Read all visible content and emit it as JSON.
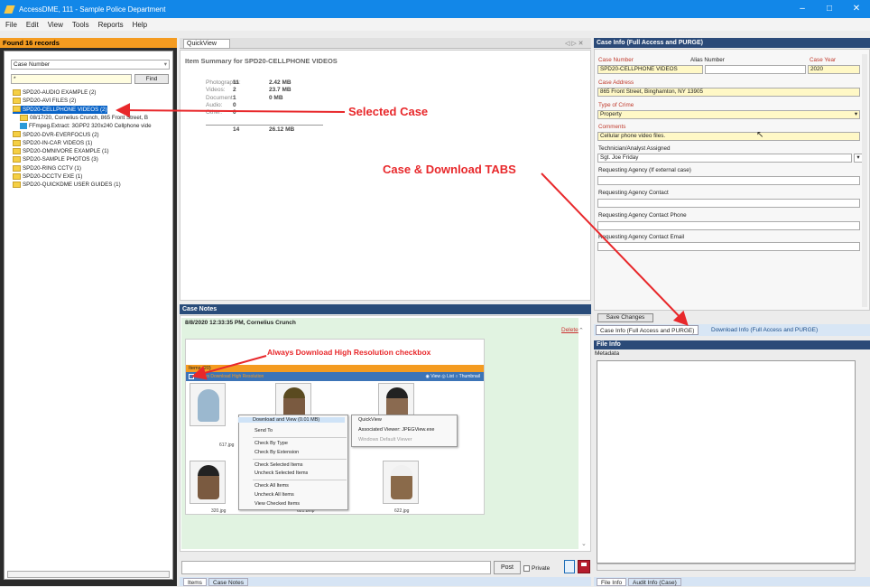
{
  "window": {
    "title": "AccessDME, 111 - Sample Police Department",
    "minimize": "–",
    "maximize": "□",
    "close": "✕"
  },
  "menu": [
    "File",
    "Edit",
    "View",
    "Tools",
    "Reports",
    "Help"
  ],
  "left": {
    "header": "Found 16 records",
    "search_field": "Case Number",
    "search_value": "*",
    "find_label": "Find",
    "tree": [
      {
        "label": "SPD20-AUDIO EXAMPLE (2)",
        "type": "folder",
        "indent": 0
      },
      {
        "label": "SPD20-AVI FILES (2)",
        "type": "folder",
        "indent": 0
      },
      {
        "label": "SPD20-CELLPHONE VIDEOS (2)",
        "type": "folder",
        "indent": 0,
        "selected": true
      },
      {
        "label": "08/17/20, Cornelius Crunch, 865 Front Street, B",
        "type": "folder",
        "indent": 1
      },
      {
        "label": "FFmpeg.Extract: 3GPP2 320x240 Cellphone vide",
        "type": "file",
        "indent": 1
      },
      {
        "label": "SPD20-DVR-EVERFOCUS (2)",
        "type": "folder",
        "indent": 0
      },
      {
        "label": "SPD20-IN-CAR VIDEOS (1)",
        "type": "folder",
        "indent": 0
      },
      {
        "label": "SPD20-OMNIVORE EXAMPLE (1)",
        "type": "folder",
        "indent": 0
      },
      {
        "label": "SPD20-SAMPLE PHOTOS (3)",
        "type": "folder",
        "indent": 0
      },
      {
        "label": "SPD20-RING CCTV (1)",
        "type": "folder",
        "indent": 0
      },
      {
        "label": "SPD20-DCCTV EXE (1)",
        "type": "folder",
        "indent": 0
      },
      {
        "label": "SPD20-QUICKDME USER GUIDES (1)",
        "type": "folder",
        "indent": 0
      }
    ]
  },
  "quickview": {
    "tab": "QuickView",
    "nav": "◁ ▷ ✕",
    "summary_title": "Item Summary for SPD20-CELLPHONE VIDEOS",
    "rows": [
      {
        "label": "Photographs:",
        "count": "11",
        "size": "2.42 MB"
      },
      {
        "label": "Videos:",
        "count": "2",
        "size": "23.7 MB"
      },
      {
        "label": "Document:",
        "count": "1",
        "size": "0 MB"
      },
      {
        "label": "Audio:",
        "count": "0",
        "size": ""
      },
      {
        "label": "Other:",
        "count": "0",
        "size": ""
      }
    ],
    "total_count": "14",
    "total_size": "26.12 MB"
  },
  "notes": {
    "header": "Case Notes",
    "author": "8/8/2020 12:33:35 PM, Cornelius Crunch",
    "delete_label": "Delete",
    "embedded": {
      "items_bar": "Items (20)",
      "toolbar_left": "Always Download High Resolution",
      "toolbar_right": "◉ View ◎ List ○ Thumbnail",
      "thumb_labels": [
        "617.jpg",
        "320.jpg",
        "621.bmp",
        "622.jpg"
      ],
      "context_menu": [
        "Download and View (0.01 MB)",
        "Send To",
        "Check By Type",
        "Check By Extension",
        "Check Selected Items",
        "Uncheck Selected Items",
        "Check All Items",
        "Uncheck All Items",
        "View Checked Items"
      ],
      "submenu": [
        "QuickView",
        "Associated Viewer: JPEGView.exe",
        "Windows Default Viewer"
      ]
    },
    "post_label": "Post",
    "private_label": "Private"
  },
  "mid_tabs": [
    "Items",
    "Case Notes"
  ],
  "right": {
    "header": "Case Info (Full Access and PURGE)",
    "case_number_label": "Case Number",
    "alias_label": "Alias Number",
    "year_label": "Case Year",
    "case_number": "SPD20-CELLPHONE VIDEOS",
    "case_year": "2020",
    "address_label": "Case Address",
    "address": "865 Front Street, Binghamton, NY 13905",
    "crime_label": "Type of Crime",
    "crime": "Property",
    "comments_label": "Comments",
    "comments": "Cellular phone video files.",
    "tech_label": "Technician/Analyst Assigned",
    "tech": "Sgt. Joe Friday",
    "agency_label": "Requesting Agency (If external case)",
    "contact_label": "Requesting Agency Contact",
    "phone_label": "Requesting Agency Contact Phone",
    "email_label": "Requesting Agency Contact Email",
    "save_label": "Save Changes",
    "tabs": [
      "Case Info (Full Access and PURGE)",
      "Download Info (Full Access and PURGE)"
    ],
    "fileinfo_header": "File Info",
    "metadata_label": "Metadata",
    "bottom_tabs": [
      "File Info",
      "Audit Info (Case)"
    ]
  },
  "annotations": {
    "selected_case": "Selected Case",
    "tabs": "Case & Download TABS",
    "checkbox": "Always Download High Resolution checkbox"
  },
  "colors": {
    "titlebar": "#1287e8",
    "orange": "#f49b20",
    "navy": "#2b4a78",
    "annotation": "#e8282b",
    "selection": "#0a64c8"
  }
}
